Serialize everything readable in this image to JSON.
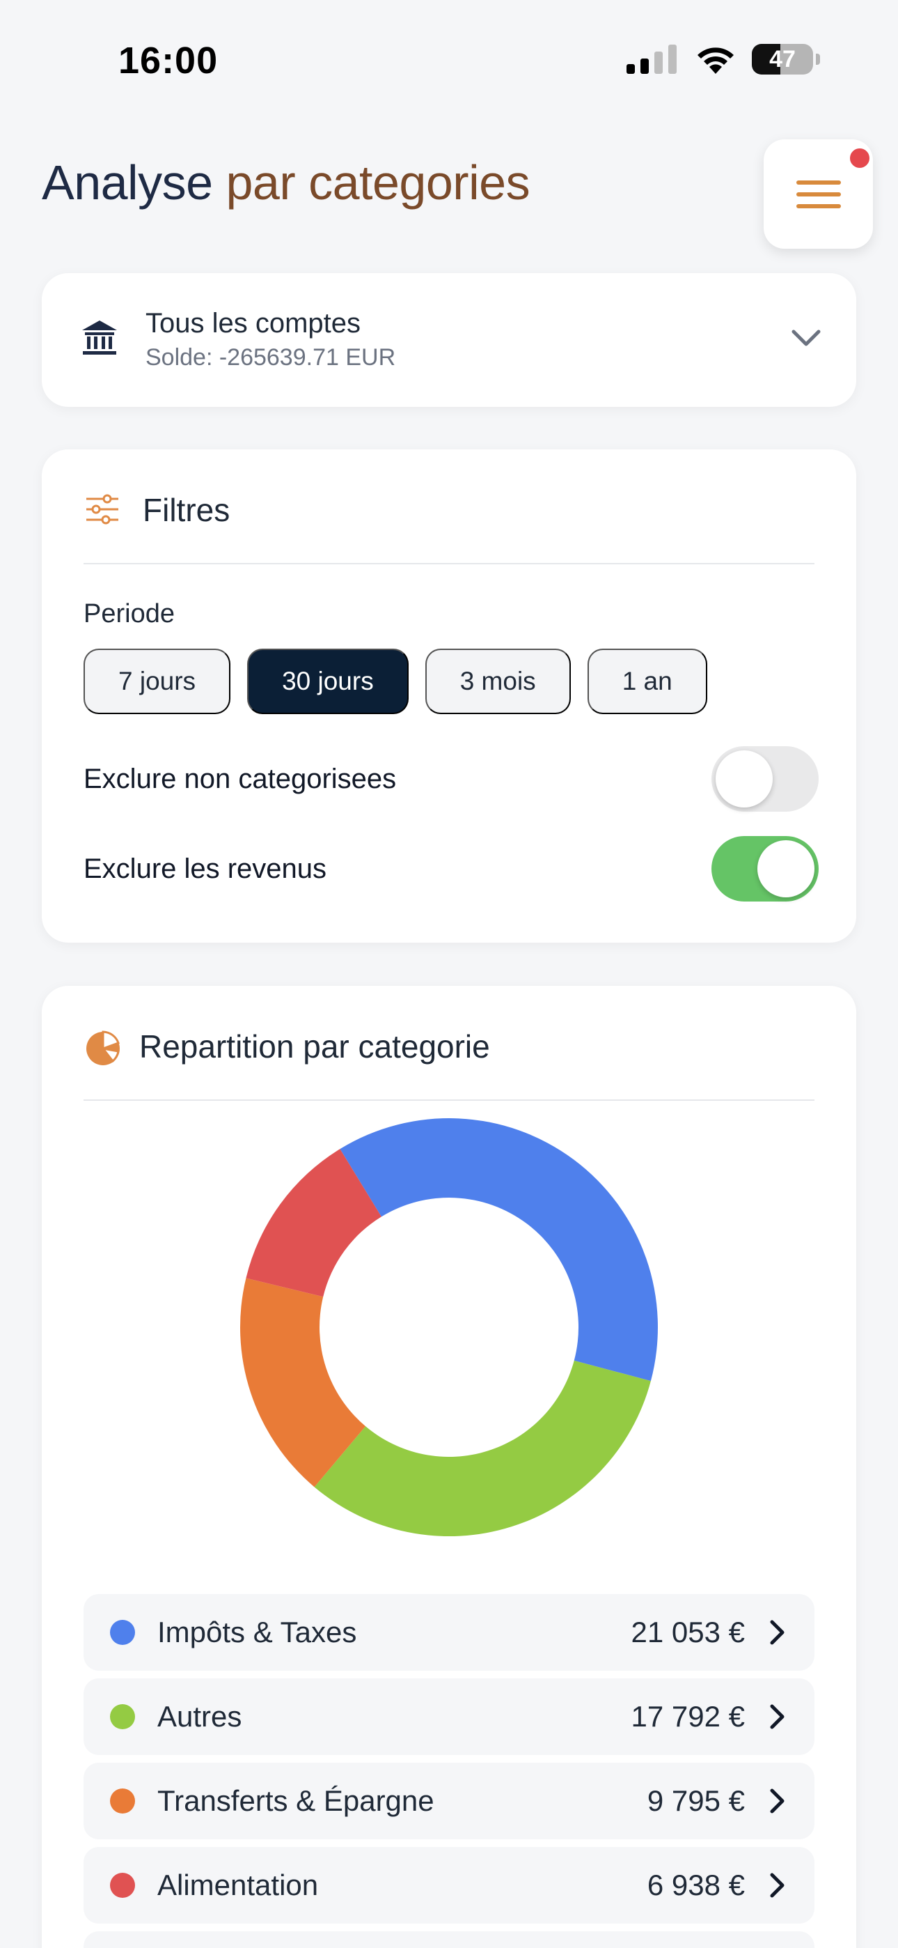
{
  "status_bar": {
    "time": "16:00",
    "battery": "47",
    "battery_level": 0.47
  },
  "header": {
    "title_part1": "Analyse ",
    "title_part2": "par categories",
    "has_notification": true
  },
  "account": {
    "name": "Tous les comptes",
    "balance": "Solde: -265639.71 EUR"
  },
  "filters": {
    "title": "Filtres",
    "period_label": "Periode",
    "periods": [
      {
        "label": "7 jours",
        "active": false
      },
      {
        "label": "30 jours",
        "active": true
      },
      {
        "label": "3 mois",
        "active": false
      },
      {
        "label": "1 an",
        "active": false
      }
    ],
    "toggles": [
      {
        "label": "Exclure non categorisees",
        "on": false
      },
      {
        "label": "Exclure les revenus",
        "on": true
      }
    ]
  },
  "breakdown": {
    "title": "Repartition par categorie",
    "items": [
      {
        "name": "Impôts & Taxes",
        "value": "21 053 €",
        "color": "#4f80ec"
      },
      {
        "name": "Autres",
        "value": "17 792 €",
        "color": "#94cb43"
      },
      {
        "name": "Transferts & Épargne",
        "value": "9 795 €",
        "color": "#e97b37"
      },
      {
        "name": "Alimentation",
        "value": "6 938 €",
        "color": "#e05252"
      }
    ]
  },
  "chart_data": {
    "type": "pie",
    "categories": [
      "Impôts & Taxes",
      "Autres",
      "Transferts & Épargne",
      "Alimentation"
    ],
    "values": [
      21053,
      17792,
      9795,
      6938
    ],
    "colors": [
      "#4f80ec",
      "#94cb43",
      "#e97b37",
      "#e05252"
    ],
    "title": "Repartition par categorie"
  }
}
